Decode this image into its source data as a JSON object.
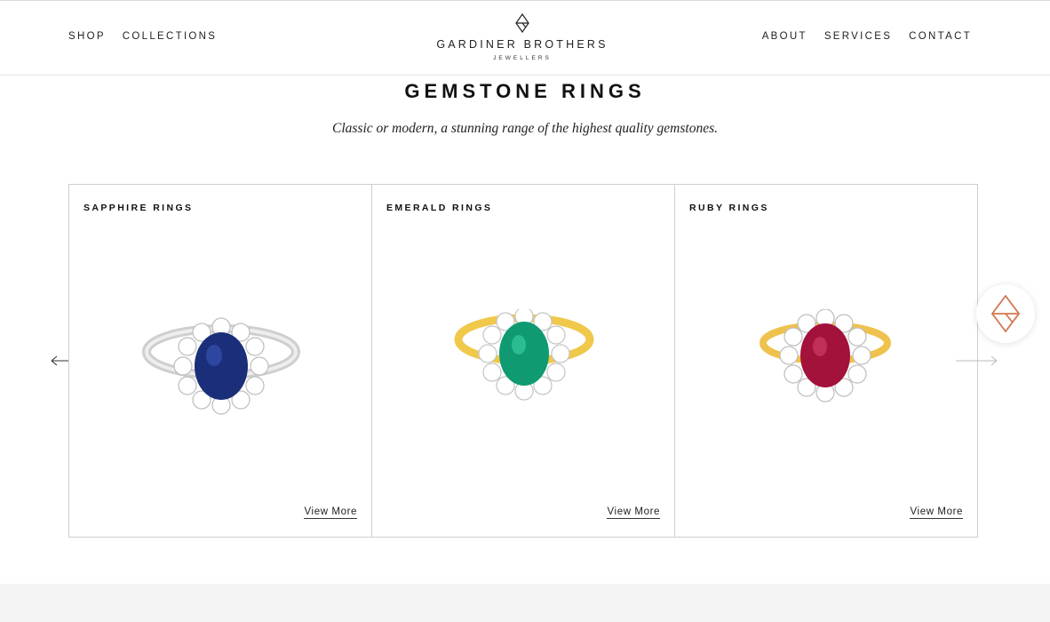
{
  "nav": {
    "left": [
      "SHOP",
      "COLLECTIONS"
    ],
    "right": [
      "ABOUT",
      "SERVICES",
      "CONTACT"
    ]
  },
  "logo": {
    "name": "GARDINER BROTHERS",
    "sub": "JEWELLERS",
    "icon": "diamond-logo-icon"
  },
  "page": {
    "title": "GEMSTONE RINGS",
    "subtitle": "Classic or modern, a stunning range of the highest quality gemstones."
  },
  "cards": [
    {
      "title": "SAPPHIRE RINGS",
      "link": "View More",
      "image": "sapphire-ring",
      "stone_color": "#1b2e7a",
      "band_color": "#d9d9d9"
    },
    {
      "title": "EMERALD RINGS",
      "link": "View More",
      "image": "emerald-ring",
      "stone_color": "#0f9a72",
      "band_color": "#f0c84a"
    },
    {
      "title": "RUBY RINGS",
      "link": "View More",
      "image": "ruby-ring",
      "stone_color": "#a3123a",
      "band_color": "#efc24d"
    }
  ],
  "carousel": {
    "prev_icon": "arrow-left-icon",
    "next_icon": "arrow-right-icon"
  },
  "chat_badge": {
    "icon": "brand-chat-icon",
    "accent": "#d2774e"
  }
}
